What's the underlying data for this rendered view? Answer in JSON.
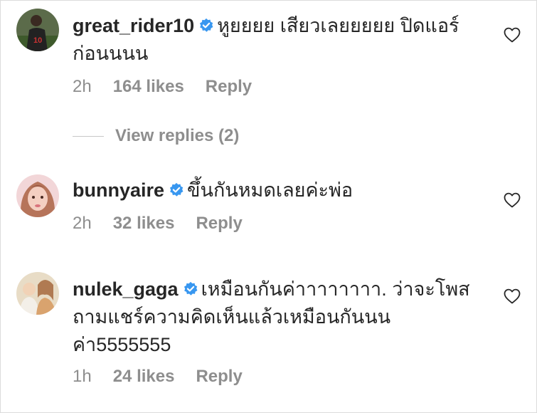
{
  "comments": [
    {
      "username": "great_rider10",
      "text": "หูยยยย เสียวเลยยยยย ปิดแอร์ก่อนนนน",
      "time": "2h",
      "likes": "164 likes",
      "reply": "Reply",
      "view_replies": "View replies (2)"
    },
    {
      "username": "bunnyaire",
      "text": "ขึ้นกันหมดเลยค่ะพ่อ",
      "time": "2h",
      "likes": "32 likes",
      "reply": "Reply"
    },
    {
      "username": "nulek_gaga",
      "text": "เหมือนกันค่าาาาาาาา. ว่าจะโพสถามแชร์ความคิดเห็นแล้วเหมือนกันนนค่า5555555",
      "time": "1h",
      "likes": "24 likes",
      "reply": "Reply"
    }
  ],
  "colors": {
    "verified": "#3897f0",
    "muted": "#8e8e8e",
    "text": "#262626"
  }
}
